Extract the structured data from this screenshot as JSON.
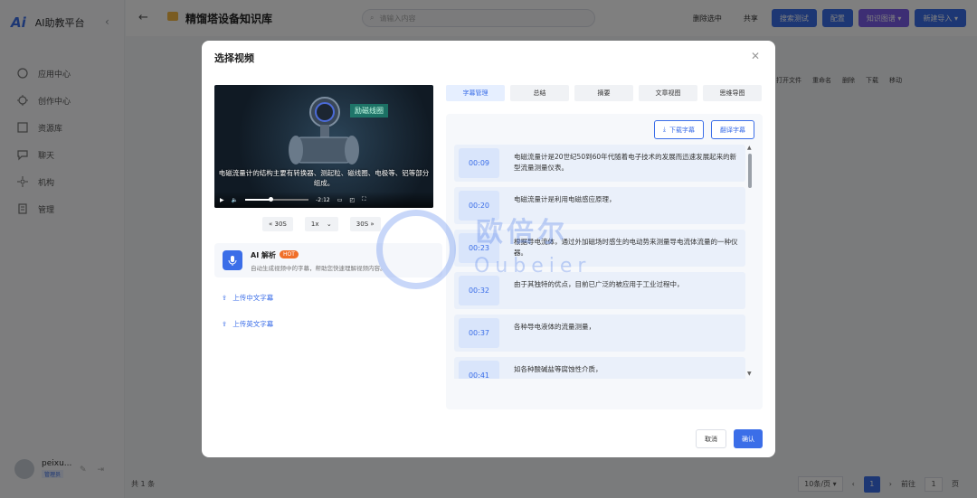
{
  "sidebar": {
    "logo": "Ai",
    "title": "AI助教平台",
    "items": [
      {
        "label": "应用中心",
        "icon": "grid-icon"
      },
      {
        "label": "创作中心",
        "icon": "bulb-icon"
      },
      {
        "label": "资源库",
        "icon": "folder-icon"
      },
      {
        "label": "聊天",
        "icon": "chat-icon"
      },
      {
        "label": "机构",
        "icon": "org-icon"
      },
      {
        "label": "管理",
        "icon": "manage-icon"
      }
    ],
    "user": {
      "name": "peixu...",
      "tag": "管理员"
    }
  },
  "header": {
    "title": "精馏塔设备知识库",
    "search_placeholder": "请输入内容",
    "buttons": [
      "删除选中",
      "共享",
      "搜索测试",
      "配置",
      "知识图谱",
      "新建导入"
    ]
  },
  "table_ops": [
    "打开文件",
    "重命名",
    "删除",
    "下载",
    "移动"
  ],
  "footer": {
    "total": "共 1 条",
    "page_size": "10条/页",
    "current_page": "1",
    "goto_label": "前往",
    "goto_value": "1",
    "page_unit": "页"
  },
  "modal": {
    "title": "选择视频",
    "video": {
      "overlay_tag": "励磁线圈",
      "subtitle": "电磁流量计的结构主要有转换器、测起粒、磁线圈、电极等、铝等部分组成。",
      "time": "-2:12",
      "progress": 0.4
    },
    "controls": {
      "back": "« 30S",
      "speed": "1x",
      "forward": "30S »"
    },
    "ai": {
      "title": "AI 解析",
      "badge": "HOT",
      "desc": "自动生成视频中的字幕，帮助您快速理解视频内容。"
    },
    "uploads": [
      "上传中文字幕",
      "上传英文字幕"
    ],
    "tabs": [
      "字幕管理",
      "总结",
      "摘要",
      "文章视图",
      "思维导图"
    ],
    "actions": {
      "download": "下载字幕",
      "translate": "翻译字幕"
    },
    "subtitles": [
      {
        "time": "00:09",
        "text": "电磁流量计是20世纪50到60年代随着电子技术的发展而迅速发展起来的新型流量测量仪表。"
      },
      {
        "time": "00:20",
        "text": "电磁流量计是利用电磁感应原理，"
      },
      {
        "time": "00:23",
        "text": "根据导电流体，通过外加磁场时感生的电动势来测量导电流体流量的一种仪器。"
      },
      {
        "time": "00:32",
        "text": "由于其独特的优点，目前已广泛的被应用于工业过程中，"
      },
      {
        "time": "00:37",
        "text": "各种导电液体的流量测量，"
      },
      {
        "time": "00:41",
        "text": "如各种酸碱盐等腐蚀性介质，"
      }
    ],
    "footer": {
      "cancel": "取消",
      "confirm": "确认"
    }
  },
  "watermark": {
    "cn": "欧倍尔",
    "en": "Oubeier"
  },
  "colors": {
    "primary": "#3b6ee8",
    "purple": "#7b5ce8",
    "hot": "#f06f2a"
  }
}
